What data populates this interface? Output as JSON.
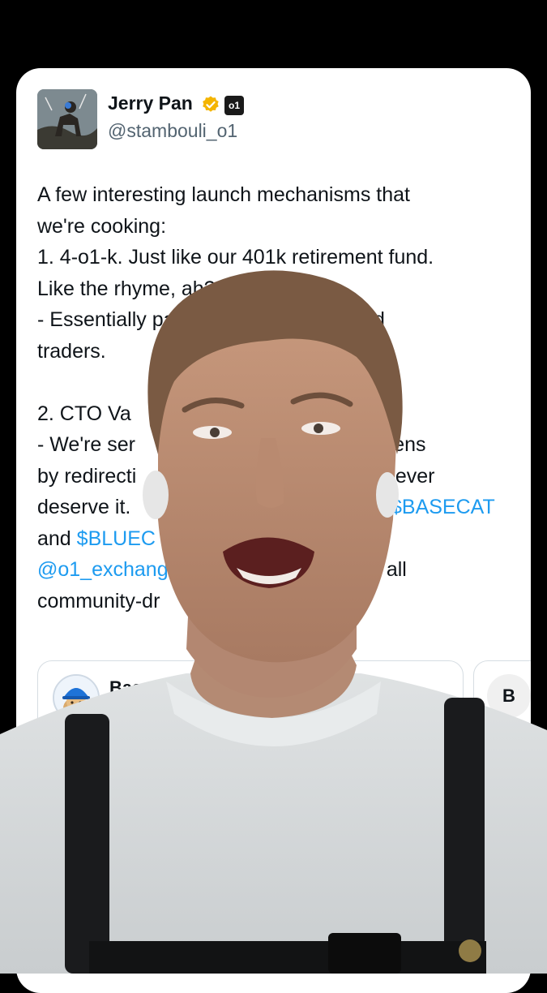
{
  "post": {
    "author_name": "Jerry Pan",
    "author_handle": "@stambouli_o1",
    "affiliate_badge_text": "o1",
    "lines": [
      {
        "parts": [
          {
            "text": "A few interesting launch mechanisms that"
          }
        ]
      },
      {
        "parts": [
          {
            "text": "we're cooking:"
          }
        ]
      },
      {
        "parts": [
          {
            "text": "1. 4-o1-k. Just like our 401k retirement fund."
          }
        ]
      },
      {
        "parts": [
          {
            "text": "Like the rhyme, ah?"
          }
        ]
      },
      {
        "parts": [
          {
            "text": "- Essentially pa"
          },
          {
            "text": "lers and",
            "gap": 340
          }
        ]
      },
      {
        "parts": [
          {
            "text": "traders."
          }
        ]
      },
      {
        "parts": [
          {
            "text": ""
          }
        ]
      },
      {
        "parts": [
          {
            "text": "2. CTO Va"
          }
        ]
      },
      {
        "parts": [
          {
            "text": "- We're ser"
          },
          {
            "text": "nity tokens",
            "gap": 360
          }
        ]
      },
      {
        "parts": [
          {
            "text": "by redirecti"
          },
          {
            "text": "whoever",
            "gap": 396
          }
        ]
      },
      {
        "parts": [
          {
            "text": "deserve it."
          },
          {
            "text": "$BASECAT",
            "link": true,
            "gap": 436
          }
        ]
      },
      {
        "parts": [
          {
            "text": "and "
          },
          {
            "text": "$BLUEC",
            "link": true
          }
        ]
      },
      {
        "parts": [
          {
            "text": "@o1_exchang",
            "link": true
          },
          {
            "text": "e all",
            "gap": 410
          }
        ]
      },
      {
        "parts": [
          {
            "text": "community-dr"
          }
        ]
      }
    ]
  },
  "quote_cards": [
    {
      "name": "Bas"
    },
    {
      "avatar_letter": "B"
    }
  ],
  "colors": {
    "link": "#1d9bf0",
    "verified_badge": "#f4b400",
    "text": "#0f1419",
    "secondary_text": "#536471"
  }
}
